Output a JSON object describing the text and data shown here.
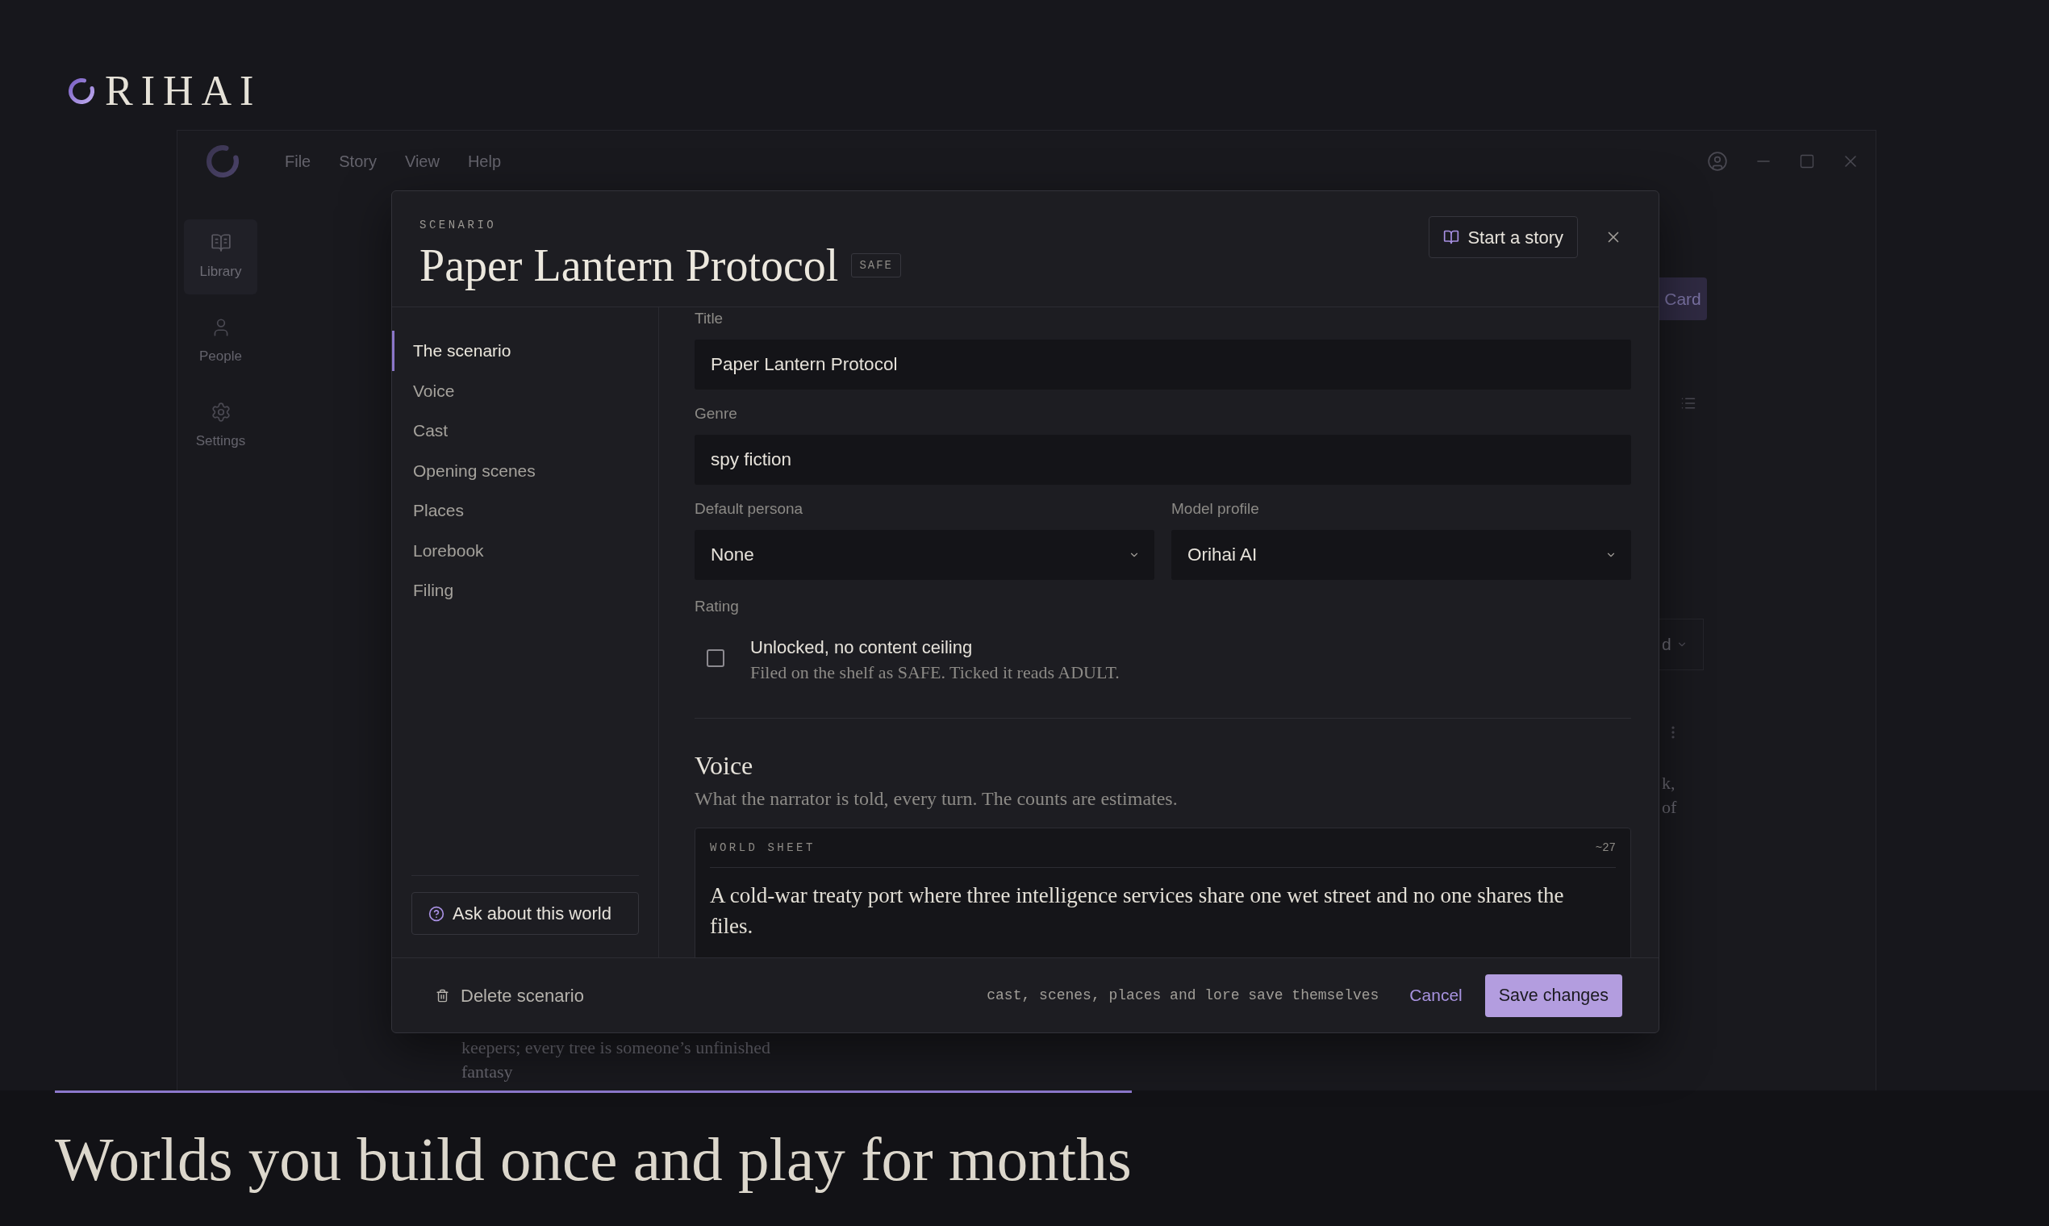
{
  "brand": {
    "name": "RIHAI"
  },
  "app_window": {
    "menu": [
      "File",
      "Story",
      "View",
      "Help"
    ],
    "sidebar": [
      {
        "label": "Library",
        "selected": true
      },
      {
        "label": "People",
        "selected": false
      },
      {
        "label": "Settings",
        "selected": false
      }
    ],
    "background": {
      "card_button": "Card",
      "dropdown_value": "d",
      "right_text": [
        "k,",
        "of"
      ],
      "lower_text": [
        "keepers; every tree is someone’s unfinished",
        "fantasy"
      ]
    }
  },
  "dialog": {
    "eyebrow": "SCENARIO",
    "title": "Paper Lantern Protocol",
    "rating_badge": "SAFE",
    "start_button": "Start a story",
    "nav": [
      {
        "label": "The scenario",
        "selected": true
      },
      {
        "label": "Voice",
        "selected": false
      },
      {
        "label": "Cast",
        "selected": false
      },
      {
        "label": "Opening scenes",
        "selected": false
      },
      {
        "label": "Places",
        "selected": false
      },
      {
        "label": "Lorebook",
        "selected": false
      },
      {
        "label": "Filing",
        "selected": false
      }
    ],
    "ask_button": "Ask about this world",
    "fields": [
      {
        "label": "Title",
        "value": "Paper Lantern Protocol"
      },
      {
        "label": "Genre",
        "value": "spy fiction"
      }
    ],
    "selects": [
      {
        "label": "Default persona",
        "value": "None"
      },
      {
        "label": "Model profile",
        "value": "Orihai AI"
      }
    ],
    "rating": {
      "label": "Rating",
      "option": "Unlocked, no content ceiling",
      "hint": "Filed on the shelf as SAFE. Ticked it reads ADULT.",
      "checked": false
    },
    "voice": {
      "heading": "Voice",
      "description": "What the narrator is told, every turn. The counts are estimates.",
      "sheet": {
        "label": "WORLD SHEET",
        "count": "~27",
        "text": "A cold-war treaty port where three intelligence services share one wet street and no one shares the files."
      }
    },
    "footer": {
      "delete": "Delete scenario",
      "note": "cast, scenes, places and lore save themselves",
      "cancel": "Cancel",
      "save": "Save changes"
    }
  },
  "tagline": "Worlds you build once and play for months"
}
